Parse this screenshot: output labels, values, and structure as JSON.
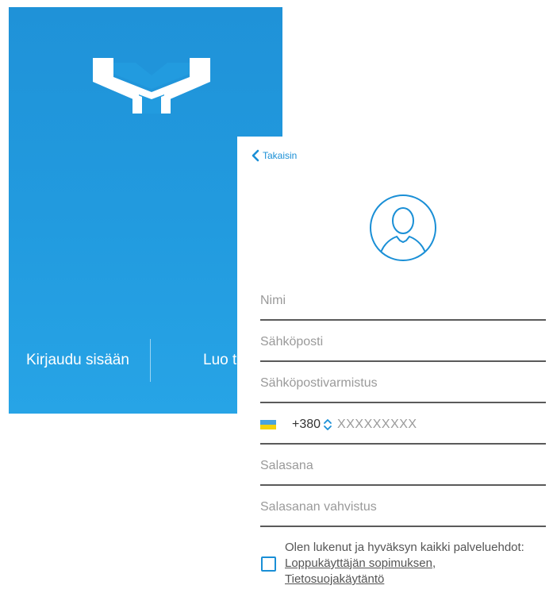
{
  "colors": {
    "accent": "#1a8fd6",
    "welcome_background": "#229bdf",
    "field_underline": "#5a5a5a",
    "placeholder": "#9a9a9a"
  },
  "welcome": {
    "logo_icon": "brand-logo-icon",
    "login_label": "Kirjaudu sisään",
    "register_label": "Luo t"
  },
  "register": {
    "back_icon": "chevron-left-icon",
    "back_label": "Takaisin",
    "avatar_icon": "user-avatar-icon",
    "fields": {
      "name": {
        "placeholder": "Nimi"
      },
      "email": {
        "placeholder": "Sähköposti"
      },
      "email_confirm": {
        "placeholder": "Sähköpostivarmistus"
      },
      "phone": {
        "flag_icon": "ukraine-flag-icon",
        "country_code": "+380",
        "stepper_icon": "up-down-chevron-icon",
        "placeholder": "XXXXXXXXX"
      },
      "password": {
        "placeholder": "Salasana"
      },
      "password_confirm": {
        "placeholder": "Salasanan vahvistus"
      }
    },
    "terms": {
      "checked": false,
      "text": "Olen lukenut ja hyväksyn kaikki palveluehdot:",
      "eula_link": "Loppukäyttäjän sopimuksen",
      "separator": ",",
      "privacy_link": "Tietosuojakäytäntö"
    }
  }
}
